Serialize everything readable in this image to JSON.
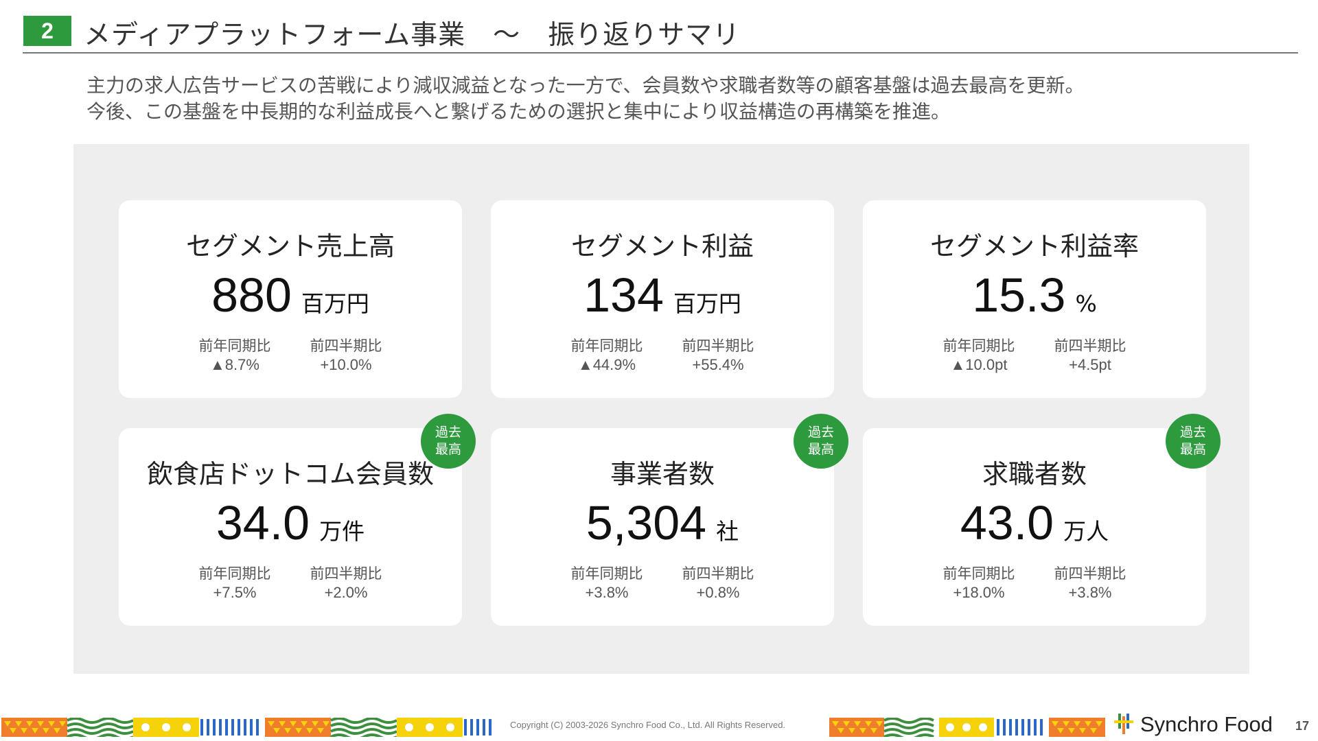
{
  "header": {
    "section_number": "2",
    "title": "メディアプラットフォーム事業　～　振り返りサマリ"
  },
  "lead": {
    "line1": "主力の求人広告サービスの苦戦により減収減益となった一方で、会員数や求職者数等の顧客基盤は過去最高を更新。",
    "line2": "今後、この基盤を中長期的な利益成長へと繋げるための選択と集中により収益構造の再構築を推進。"
  },
  "stat_labels": {
    "yoy": "前年同期比",
    "qoq": "前四半期比"
  },
  "record_badge": {
    "line1": "過去",
    "line2": "最高"
  },
  "cards": [
    {
      "title": "セグメント売上高",
      "value": "880",
      "unit": "百万円",
      "yoy": "▲8.7%",
      "qoq": "+10.0%",
      "record": false
    },
    {
      "title": "セグメント利益",
      "value": "134",
      "unit": "百万円",
      "yoy": "▲44.9%",
      "qoq": "+55.4%",
      "record": false
    },
    {
      "title": "セグメント利益率",
      "value": "15.3",
      "unit": "%",
      "yoy": "▲10.0pt",
      "qoq": "+4.5pt",
      "record": false
    },
    {
      "title": "飲食店ドットコム会員数",
      "value": "34.0",
      "unit": "万件",
      "yoy": "+7.5%",
      "qoq": "+2.0%",
      "record": true
    },
    {
      "title": "事業者数",
      "value": "5,304",
      "unit": "社",
      "yoy": "+3.8%",
      "qoq": "+0.8%",
      "record": true
    },
    {
      "title": "求職者数",
      "value": "43.0",
      "unit": "万人",
      "yoy": "+18.0%",
      "qoq": "+3.8%",
      "record": true
    }
  ],
  "footer": {
    "copyright": "Copyright (C) 2003-2026 Synchro Food Co., Ltd. All Rights Reserved.",
    "logo_text": "Synchro Food",
    "page_number": "17"
  },
  "colors": {
    "accent_green": "#2e9a3e",
    "panel_bg": "#eeeeee",
    "pattern_orange": "#f07d2b",
    "pattern_yellow": "#f5d20a",
    "pattern_blue": "#2b67c6",
    "pattern_green": "#3c8f3c"
  }
}
